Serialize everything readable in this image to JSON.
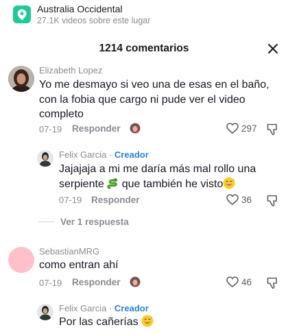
{
  "location": {
    "title": "Australia Occidental",
    "subtitle": "27.1K videos sobre este lugar",
    "icon": "location-pin-icon"
  },
  "header": {
    "title": "1214 comentarios",
    "close_icon": "close-icon"
  },
  "comments": [
    {
      "username": "Elizabeth Lopez",
      "text": "Yo me desmayo si veo una de esas en el baño, con la fobia que cargo ni pude ver el video completo",
      "date": "07-19",
      "reply_label": "Responder",
      "likes": "297"
    },
    {
      "username": "Felix Garcia",
      "separator": " · ",
      "badge": "Creador",
      "text_before": "Jajajaja a mi me daría más mal rollo una serpiente ",
      "text_after": " que también he visto",
      "date": "07-19",
      "reply_label": "Responder",
      "likes": "36"
    },
    {
      "view_replies": "Ver 1 respuesta"
    },
    {
      "username": "SebastianMRG",
      "text": "como entran ahí",
      "date": "07-19",
      "reply_label": "Responder",
      "likes": "46"
    },
    {
      "username": "Felix Garcia",
      "separator": " · ",
      "badge": "Creador",
      "text": "Por las cañerías"
    }
  ],
  "colors": {
    "accent_creator": "#2b7fd6",
    "location_icon_bg": "#20c997",
    "avatar_pink": "#ffc0cc"
  }
}
